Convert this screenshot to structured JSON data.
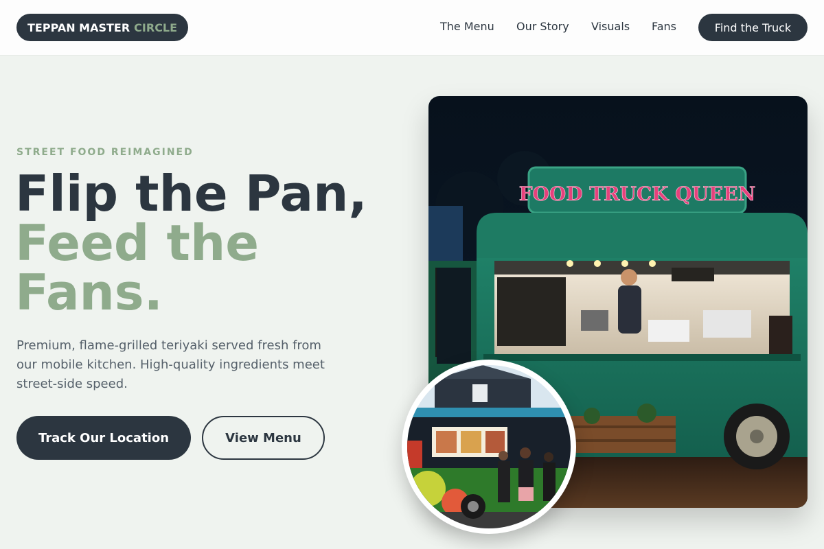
{
  "header": {
    "logo_main": "TEPPAN MASTER",
    "logo_accent": "CIRCLE",
    "nav": [
      "The Menu",
      "Our Story",
      "Visuals",
      "Fans"
    ],
    "cta_label": "Find the Truck"
  },
  "hero": {
    "eyebrow": "STREET FOOD REIMAGINED",
    "headline_line1": "Flip the Pan,",
    "headline_line2": "Feed the",
    "headline_line3": "Fans.",
    "lead": "Premium, flame-grilled teriyaki served fresh from our mobile kitchen. High-quality ingredients meet street-side speed.",
    "primary_button": "Track Our Location",
    "secondary_button": "View Menu"
  },
  "photo": {
    "truck_sign": "FOOD TRUCK QUEEN"
  },
  "colors": {
    "dark": "#2c3640",
    "accent": "#8fab8c",
    "background": "#eff3ef"
  }
}
